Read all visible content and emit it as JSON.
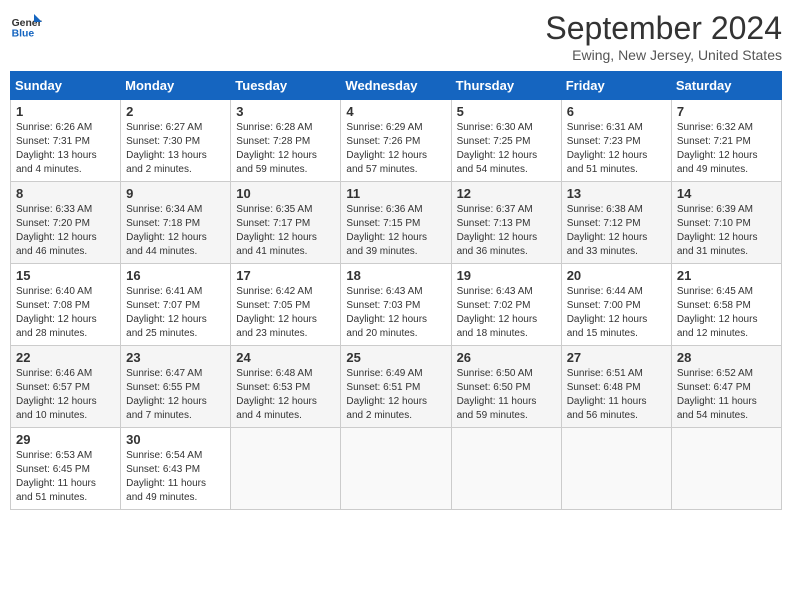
{
  "header": {
    "logo_line1": "General",
    "logo_line2": "Blue",
    "title": "September 2024",
    "location": "Ewing, New Jersey, United States"
  },
  "days_of_week": [
    "Sunday",
    "Monday",
    "Tuesday",
    "Wednesday",
    "Thursday",
    "Friday",
    "Saturday"
  ],
  "weeks": [
    [
      {
        "day": "1",
        "sunrise": "6:26 AM",
        "sunset": "7:31 PM",
        "daylight": "13 hours and 4 minutes."
      },
      {
        "day": "2",
        "sunrise": "6:27 AM",
        "sunset": "7:30 PM",
        "daylight": "13 hours and 2 minutes."
      },
      {
        "day": "3",
        "sunrise": "6:28 AM",
        "sunset": "7:28 PM",
        "daylight": "12 hours and 59 minutes."
      },
      {
        "day": "4",
        "sunrise": "6:29 AM",
        "sunset": "7:26 PM",
        "daylight": "12 hours and 57 minutes."
      },
      {
        "day": "5",
        "sunrise": "6:30 AM",
        "sunset": "7:25 PM",
        "daylight": "12 hours and 54 minutes."
      },
      {
        "day": "6",
        "sunrise": "6:31 AM",
        "sunset": "7:23 PM",
        "daylight": "12 hours and 51 minutes."
      },
      {
        "day": "7",
        "sunrise": "6:32 AM",
        "sunset": "7:21 PM",
        "daylight": "12 hours and 49 minutes."
      }
    ],
    [
      {
        "day": "8",
        "sunrise": "6:33 AM",
        "sunset": "7:20 PM",
        "daylight": "12 hours and 46 minutes."
      },
      {
        "day": "9",
        "sunrise": "6:34 AM",
        "sunset": "7:18 PM",
        "daylight": "12 hours and 44 minutes."
      },
      {
        "day": "10",
        "sunrise": "6:35 AM",
        "sunset": "7:17 PM",
        "daylight": "12 hours and 41 minutes."
      },
      {
        "day": "11",
        "sunrise": "6:36 AM",
        "sunset": "7:15 PM",
        "daylight": "12 hours and 39 minutes."
      },
      {
        "day": "12",
        "sunrise": "6:37 AM",
        "sunset": "7:13 PM",
        "daylight": "12 hours and 36 minutes."
      },
      {
        "day": "13",
        "sunrise": "6:38 AM",
        "sunset": "7:12 PM",
        "daylight": "12 hours and 33 minutes."
      },
      {
        "day": "14",
        "sunrise": "6:39 AM",
        "sunset": "7:10 PM",
        "daylight": "12 hours and 31 minutes."
      }
    ],
    [
      {
        "day": "15",
        "sunrise": "6:40 AM",
        "sunset": "7:08 PM",
        "daylight": "12 hours and 28 minutes."
      },
      {
        "day": "16",
        "sunrise": "6:41 AM",
        "sunset": "7:07 PM",
        "daylight": "12 hours and 25 minutes."
      },
      {
        "day": "17",
        "sunrise": "6:42 AM",
        "sunset": "7:05 PM",
        "daylight": "12 hours and 23 minutes."
      },
      {
        "day": "18",
        "sunrise": "6:43 AM",
        "sunset": "7:03 PM",
        "daylight": "12 hours and 20 minutes."
      },
      {
        "day": "19",
        "sunrise": "6:43 AM",
        "sunset": "7:02 PM",
        "daylight": "12 hours and 18 minutes."
      },
      {
        "day": "20",
        "sunrise": "6:44 AM",
        "sunset": "7:00 PM",
        "daylight": "12 hours and 15 minutes."
      },
      {
        "day": "21",
        "sunrise": "6:45 AM",
        "sunset": "6:58 PM",
        "daylight": "12 hours and 12 minutes."
      }
    ],
    [
      {
        "day": "22",
        "sunrise": "6:46 AM",
        "sunset": "6:57 PM",
        "daylight": "12 hours and 10 minutes."
      },
      {
        "day": "23",
        "sunrise": "6:47 AM",
        "sunset": "6:55 PM",
        "daylight": "12 hours and 7 minutes."
      },
      {
        "day": "24",
        "sunrise": "6:48 AM",
        "sunset": "6:53 PM",
        "daylight": "12 hours and 4 minutes."
      },
      {
        "day": "25",
        "sunrise": "6:49 AM",
        "sunset": "6:51 PM",
        "daylight": "12 hours and 2 minutes."
      },
      {
        "day": "26",
        "sunrise": "6:50 AM",
        "sunset": "6:50 PM",
        "daylight": "11 hours and 59 minutes."
      },
      {
        "day": "27",
        "sunrise": "6:51 AM",
        "sunset": "6:48 PM",
        "daylight": "11 hours and 56 minutes."
      },
      {
        "day": "28",
        "sunrise": "6:52 AM",
        "sunset": "6:47 PM",
        "daylight": "11 hours and 54 minutes."
      }
    ],
    [
      {
        "day": "29",
        "sunrise": "6:53 AM",
        "sunset": "6:45 PM",
        "daylight": "11 hours and 51 minutes."
      },
      {
        "day": "30",
        "sunrise": "6:54 AM",
        "sunset": "6:43 PM",
        "daylight": "11 hours and 49 minutes."
      },
      null,
      null,
      null,
      null,
      null
    ]
  ]
}
